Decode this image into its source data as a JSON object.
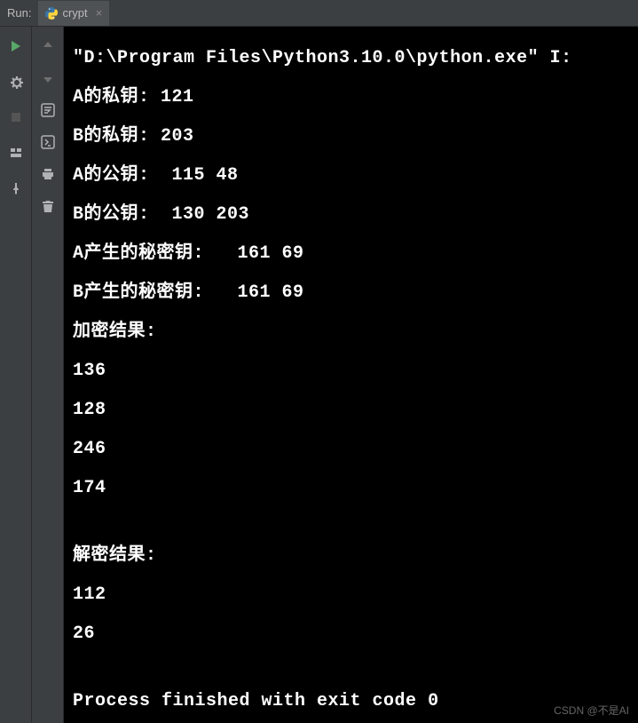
{
  "header": {
    "run_label": "Run:",
    "tab_name": "crypt"
  },
  "console": {
    "lines": [
      "\"D:\\Program Files\\Python3.10.0\\python.exe\" I:",
      "A的私钥: 121",
      "B的私钥: 203",
      "A的公钥:  115 48",
      "B的公钥:  130 203",
      "A产生的秘密钥:   161 69",
      "B产生的秘密钥:   161 69",
      "加密结果:",
      "136",
      "128",
      "246",
      "174",
      "",
      "解密结果:",
      "112",
      "26",
      "",
      "Process finished with exit code 0"
    ]
  },
  "watermark": "CSDN @不是AI"
}
